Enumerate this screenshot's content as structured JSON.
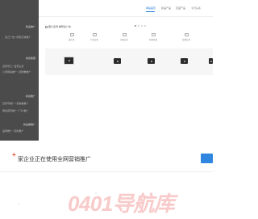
{
  "nav": {
    "items": [
      "网站首页",
      "新品产品",
      "百度产品",
      "今日头条"
    ],
    "active_index": 0
  },
  "sidebar": {
    "sections": [
      {
        "heading": "新品推广",
        "lines": [
          "、自己广告  / 网页实体推广"
        ]
      },
      {
        "heading": "热线客服",
        "lines": [
          "百家号口 / 百家主页",
          "公司网站推广  / 招聘推推广"
        ]
      },
      {
        "heading": "新闻推广",
        "lines": [
          "百家号推广 / 微信推推广",
          "网站项目推广 / 门户推广"
        ]
      },
      {
        "heading": "新品推推广",
        "lines": [
          "品牌推广 / 招标推广"
        ]
      }
    ]
  },
  "ad": {
    "title": "图片名称:推荐投广告",
    "items": [
      "图片名",
      "行业分析",
      "全国分布",
      "新闻月报",
      "营销业务"
    ]
  },
  "carousel": {
    "count": 4,
    "active": 0
  },
  "banner": {
    "plus": "+",
    "text": "家企业正在使用全网营销推广"
  },
  "watermark": {
    "text": "0401导航库"
  },
  "colors": {
    "accent": "#1e7ae0",
    "sidebar": "#4b4b4b",
    "banner_plus": "#e8412c",
    "button": "#2e86de"
  },
  "icons": {
    "play": "play-icon",
    "image": "image-icon"
  }
}
